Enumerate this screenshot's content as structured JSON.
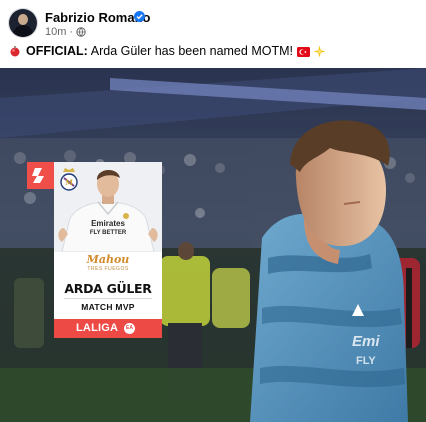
{
  "post": {
    "author": "Fabrizio Romano",
    "time": "10m",
    "separator": "·",
    "text_label": "OFFICIAL:",
    "text_body": "Arda Güler has been named MOTM!"
  },
  "graphic": {
    "sponsor": "Mahou",
    "sponsor_sub": "TRES FUEGOS",
    "player_name": "ARDA GÜLER",
    "award": "MATCH MVP",
    "league": "LALIGA",
    "ea": "EA"
  },
  "icons": [
    "verified-icon",
    "globe-icon",
    "red-ball-emoji-icon",
    "turkey-flag-icon",
    "sparkle-icon",
    "laliga-logo-icon",
    "real-madrid-crest-icon"
  ],
  "colors": {
    "verified_blue": "#1877f2",
    "meta_gray": "#65676b",
    "laliga_red": "#ee4a45"
  }
}
